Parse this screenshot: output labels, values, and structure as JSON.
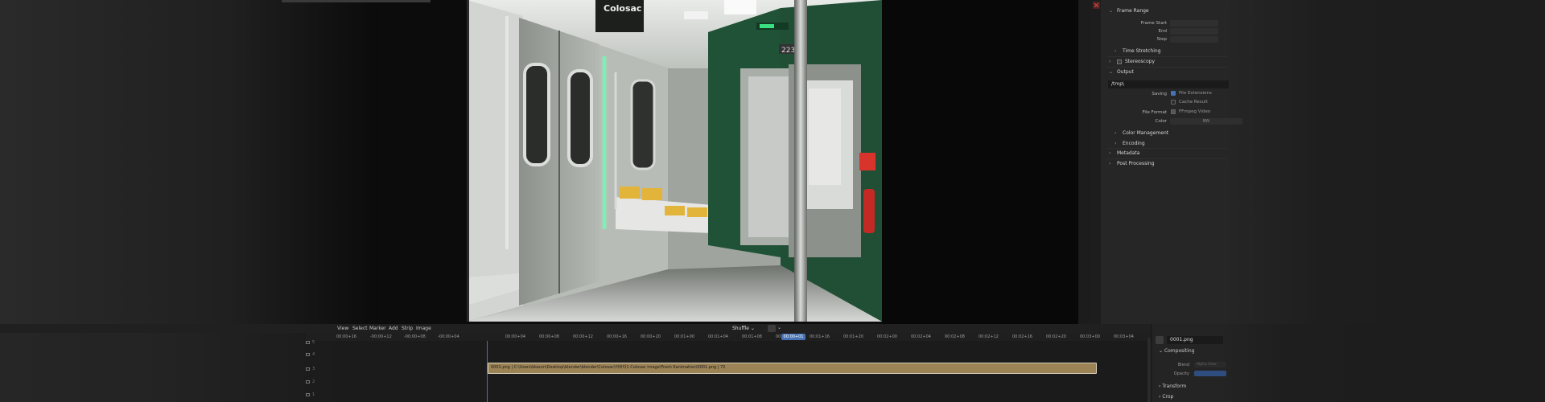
{
  "properties": {
    "frame_range": {
      "title": "Frame Range",
      "start_label": "Frame Start",
      "end_label": "End",
      "step_label": "Step"
    },
    "time_stretching": "Time Stretching",
    "stereoscopy": "Stereoscopy",
    "output": {
      "title": "Output",
      "path": "/tmp\\",
      "saving_label": "Saving",
      "file_extensions": "File Extensions",
      "cache_result": "Cache Result",
      "file_format_label": "File Format",
      "file_format": "FFmpeg Video",
      "color_label": "Color",
      "color_value": "BW"
    },
    "color_management": "Color Management",
    "encoding": "Encoding",
    "metadata": "Metadata",
    "post_processing": "Post Processing"
  },
  "sequencer": {
    "menu": [
      "View",
      "Select",
      "Marker",
      "Add",
      "Strip",
      "Image"
    ],
    "snap_mode": "Shuffle",
    "timecodes": [
      "00:00+16",
      "-00:00+12",
      "-00:00+08",
      "-00:00+04",
      "00:00+04",
      "00:00+08",
      "00:00+12",
      "00:00+16",
      "00:00+20",
      "00:01+00",
      "00:01+04",
      "00:01+08",
      "00:01+12",
      "00:01+16",
      "00:01+20",
      "00:02+00",
      "00:02+04",
      "00:02+08",
      "00:02+12",
      "00:02+16",
      "00:02+20",
      "00:03+00",
      "00:03+04"
    ],
    "current_time": "00:00+01",
    "channels": [
      "5",
      "4",
      "3",
      "2",
      "1"
    ],
    "strip_label": "0001.png | C:\\Users\\kkeum\\Desktop\\blender\\blender\\Colosac\\아바타1 Colosac image\\Fresh Kanimation\\0001.png | 72"
  },
  "strip_panel": {
    "name": "0001.png",
    "compositing": "Compositing",
    "blend_label": "Blend",
    "blend_value": "Alpha Over",
    "opacity_label": "Opacity",
    "transform": "Transform",
    "crop": "Crop"
  },
  "render": {
    "sign_text": "Colosac"
  },
  "colors": {
    "accent": "#4772b3",
    "strip": "#9c8356",
    "green_wall": "#1f5236"
  }
}
